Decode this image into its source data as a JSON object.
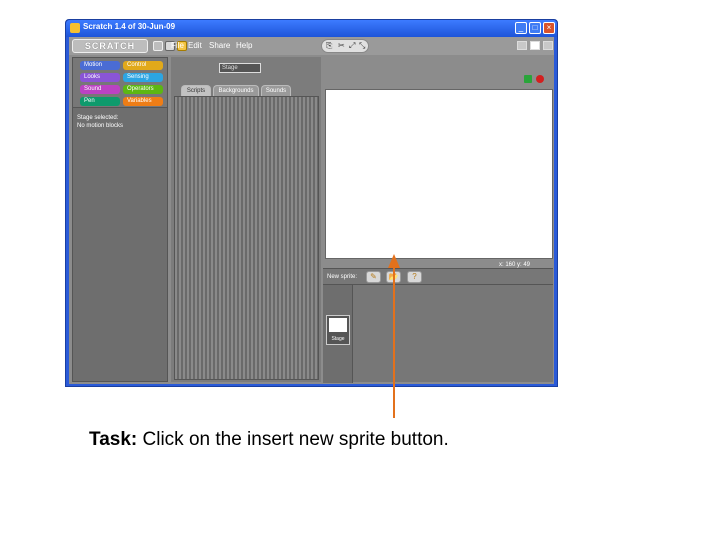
{
  "window": {
    "title": "Scratch 1.4 of 30-Jun-09",
    "minimize": "_",
    "maximize": "□",
    "close": "×"
  },
  "menubar": {
    "logo": "SCRATCH",
    "menus": [
      "File",
      "Edit",
      "Share",
      "Help"
    ]
  },
  "palette": {
    "categories": [
      {
        "label": "Motion",
        "color": "#4a6cd4"
      },
      {
        "label": "Control",
        "color": "#e1a91a"
      },
      {
        "label": "Looks",
        "color": "#8a55d7"
      },
      {
        "label": "Sensing",
        "color": "#2ca5e2"
      },
      {
        "label": "Sound",
        "color": "#bb42c3"
      },
      {
        "label": "Operators",
        "color": "#5cb712"
      },
      {
        "label": "Pen",
        "color": "#0e9a6c"
      },
      {
        "label": "Variables",
        "color": "#ee7d16"
      }
    ],
    "message_line1": "Stage selected:",
    "message_line2": "No motion blocks"
  },
  "scripts": {
    "sprite_name": "Stage",
    "tabs": [
      "Scripts",
      "Backgrounds",
      "Sounds"
    ]
  },
  "stage": {
    "coords": "x: 160   y: 49",
    "new_sprite_label": "New sprite:",
    "thumb_label": "Stage"
  },
  "annotation": {
    "task_label": "Task:",
    "task_text": " Click on the insert new sprite button.",
    "arrow_color": "#e3711c"
  }
}
